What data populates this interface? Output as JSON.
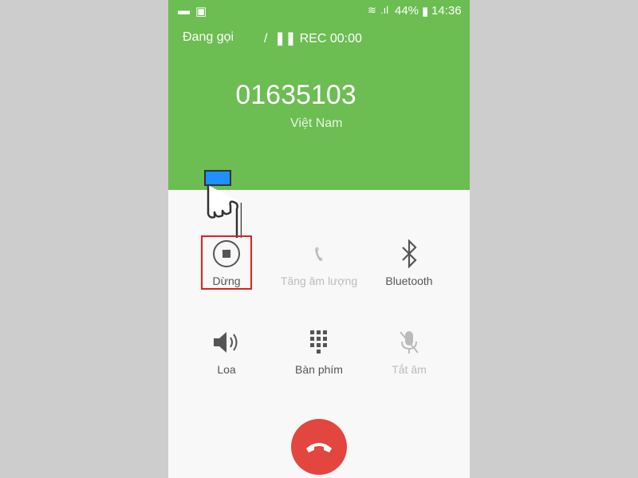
{
  "statusbar": {
    "battery": "44%",
    "time": "14:36",
    "icons": [
      "message-icon",
      "image-icon",
      "wifi-icon",
      "signal-icon",
      "battery-icon"
    ]
  },
  "call": {
    "status": "Đang gọi",
    "separator": "/",
    "rec": "REC 00:00",
    "number": "01635103",
    "country": "Việt Nam"
  },
  "buttons": [
    {
      "label": "Dừng",
      "icon": "stop-icon",
      "enabled": true
    },
    {
      "label": "Tăng âm lượng",
      "icon": "volume-boost-icon",
      "enabled": false
    },
    {
      "label": "Bluetooth",
      "icon": "bluetooth-icon",
      "enabled": true
    },
    {
      "label": "Loa",
      "icon": "speaker-icon",
      "enabled": true
    },
    {
      "label": "Bàn phím",
      "icon": "keypad-icon",
      "enabled": true
    },
    {
      "label": "Tắt âm",
      "icon": "mute-icon",
      "enabled": false
    }
  ],
  "colors": {
    "header": "#6cbd52",
    "end_call": "#e2463f",
    "highlight": "#e02020"
  }
}
